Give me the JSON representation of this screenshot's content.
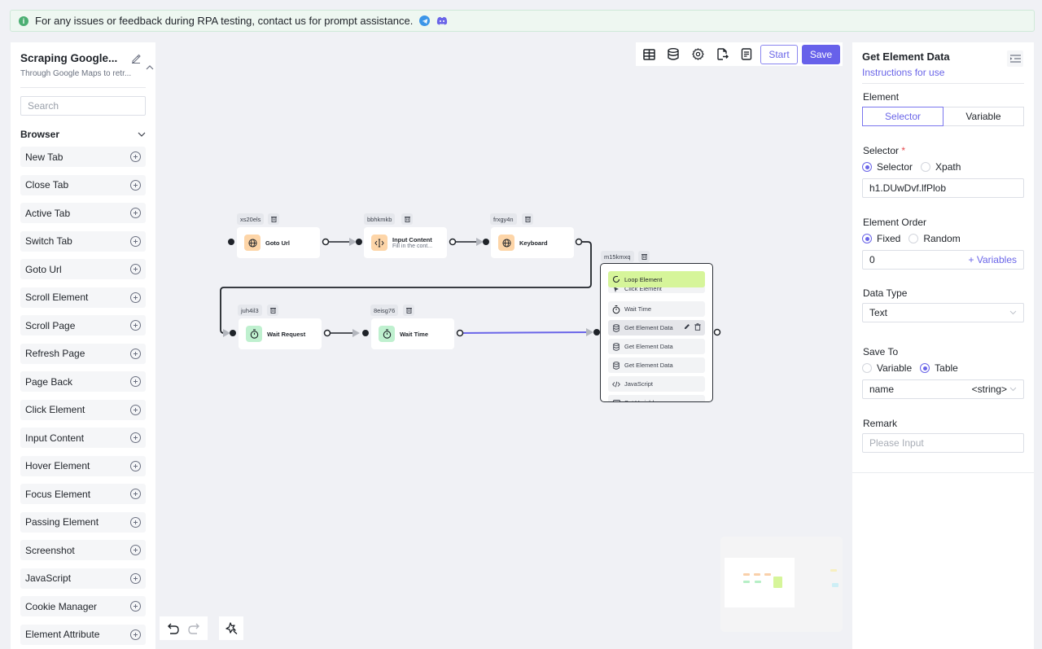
{
  "notice": {
    "text": "For any issues or feedback during RPA testing, contact us for prompt assistance.",
    "icons": [
      "info-icon",
      "telegram-icon",
      "discord-icon"
    ]
  },
  "sidebar": {
    "title": "Scraping Google...",
    "subtitle": "Through Google Maps to retr...",
    "search_placeholder": "Search",
    "section": "Browser",
    "items": [
      {
        "label": "New Tab"
      },
      {
        "label": "Close Tab"
      },
      {
        "label": "Active Tab"
      },
      {
        "label": "Switch Tab"
      },
      {
        "label": "Goto Url"
      },
      {
        "label": "Scroll Element"
      },
      {
        "label": "Scroll Page"
      },
      {
        "label": "Refresh Page"
      },
      {
        "label": "Page Back"
      },
      {
        "label": "Click Element"
      },
      {
        "label": "Input Content"
      },
      {
        "label": "Hover Element"
      },
      {
        "label": "Focus Element"
      },
      {
        "label": "Passing Element"
      },
      {
        "label": "Screenshot"
      },
      {
        "label": "JavaScript"
      },
      {
        "label": "Cookie Manager"
      },
      {
        "label": "Element Attribute"
      }
    ]
  },
  "toolbar": {
    "icons": [
      "table-icon",
      "database-icon",
      "settings-icon",
      "export-icon",
      "log-icon"
    ],
    "start_label": "Start",
    "save_label": "Save"
  },
  "flow": {
    "nodes": [
      {
        "id": "xs20els",
        "title": "Goto Url",
        "subtitle": "",
        "icon": "globe-icon",
        "color": "orange"
      },
      {
        "id": "bbhkmkb",
        "title": "Input Content",
        "subtitle": "Fill in the cont...",
        "icon": "text-cursor-icon",
        "color": "orange"
      },
      {
        "id": "frxgy4n",
        "title": "Keyboard",
        "subtitle": "",
        "icon": "globe-icon",
        "color": "orange"
      },
      {
        "id": "juh4il3",
        "title": "Wait Request",
        "subtitle": "",
        "icon": "timer-icon",
        "color": "green"
      },
      {
        "id": "8eisg76",
        "title": "Wait Time",
        "subtitle": "",
        "icon": "timer-icon",
        "color": "green"
      }
    ],
    "loop": {
      "id": "m15kmxq",
      "title": "Loop Element",
      "items": [
        {
          "label": "Click Element",
          "icon": "pointer-icon"
        },
        {
          "label": "Wait Time",
          "icon": "timer-icon"
        },
        {
          "label": "Get Element Data",
          "icon": "database-icon",
          "active": true
        },
        {
          "label": "Get Element Data",
          "icon": "database-icon"
        },
        {
          "label": "Get Element Data",
          "icon": "database-icon"
        },
        {
          "label": "JavaScript",
          "icon": "code-icon"
        },
        {
          "label": "Set Variable",
          "icon": "variable-icon"
        }
      ]
    },
    "colors": {
      "orange": "#fdd5a8",
      "green": "#bff0cf",
      "loop": "#d6f59a",
      "active_edge": "#6a65e8"
    }
  },
  "panel": {
    "title": "Get Element Data",
    "link": "Instructions for use",
    "element_label": "Element",
    "element_tabs": [
      "Selector",
      "Variable"
    ],
    "element_selected": "Selector",
    "selector_label": "Selector",
    "selector_required": "*",
    "selector_modes": [
      "Selector",
      "Xpath"
    ],
    "selector_mode_selected": "Selector",
    "selector_value": "h1.DUwDvf.lfPlob",
    "order_label": "Element Order",
    "order_modes": [
      "Fixed",
      "Random"
    ],
    "order_mode_selected": "Fixed",
    "order_value": "0",
    "variables_link": "+ Variables",
    "datatype_label": "Data Type",
    "datatype_value": "Text",
    "saveto_label": "Save To",
    "saveto_modes": [
      "Variable",
      "Table"
    ],
    "saveto_selected": "Table",
    "saveto_column": "name",
    "saveto_type": "<string>",
    "remark_label": "Remark",
    "remark_placeholder": "Please Input"
  }
}
